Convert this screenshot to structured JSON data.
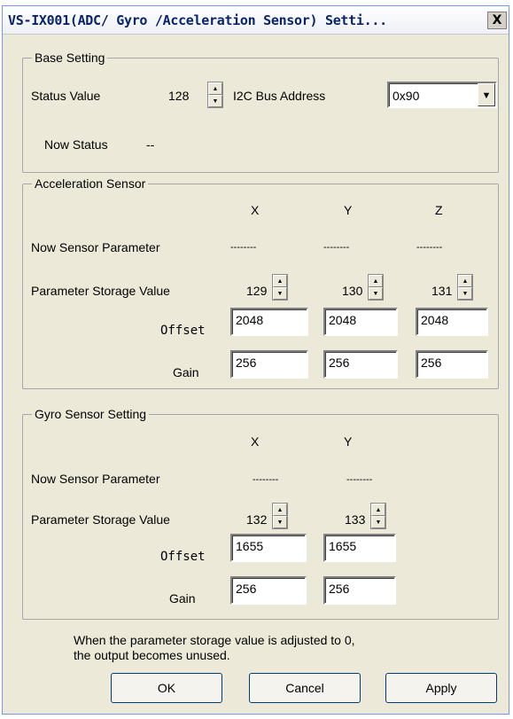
{
  "window": {
    "title": "VS-IX001(ADC/ Gyro /Acceleration Sensor) Setti...",
    "close_symbol": "X"
  },
  "base": {
    "group_title": "Base Setting",
    "status_value_label": "Status Value",
    "status_value": "128",
    "i2c_label": "I2C Bus Address",
    "i2c_selected": "0x90",
    "now_status_label": "Now Status",
    "now_status_value": "--"
  },
  "accel": {
    "group_title": "Acceleration Sensor",
    "axes": [
      "X",
      "Y",
      "Z"
    ],
    "now_param_label": "Now Sensor Parameter",
    "now_param_values": [
      "--------",
      "--------",
      "--------"
    ],
    "storage_label": "Parameter Storage Value",
    "storage_values": [
      "129",
      "130",
      "131"
    ],
    "offset_label": "Offset",
    "offset_values": [
      "2048",
      "2048",
      "2048"
    ],
    "gain_label": "Gain",
    "gain_values": [
      "256",
      "256",
      "256"
    ]
  },
  "gyro": {
    "group_title": "Gyro Sensor Setting",
    "axes": [
      "X",
      "Y"
    ],
    "now_param_label": "Now Sensor Parameter",
    "now_param_values": [
      "--------",
      "--------"
    ],
    "storage_label": "Parameter Storage Value",
    "storage_values": [
      "132",
      "133"
    ],
    "offset_label": "Offset",
    "offset_values": [
      "1655",
      "1655"
    ],
    "gain_label": "Gain",
    "gain_values": [
      "256",
      "256"
    ]
  },
  "note": {
    "line1": "When the parameter storage value is adjusted to 0,",
    "line2": "the output becomes unused."
  },
  "buttons": {
    "ok": "OK",
    "cancel": "Cancel",
    "apply": "Apply"
  },
  "icons": {
    "spin_up": "up-arrow-icon",
    "spin_down": "down-arrow-icon",
    "dropdown": "dropdown-arrow-icon"
  }
}
